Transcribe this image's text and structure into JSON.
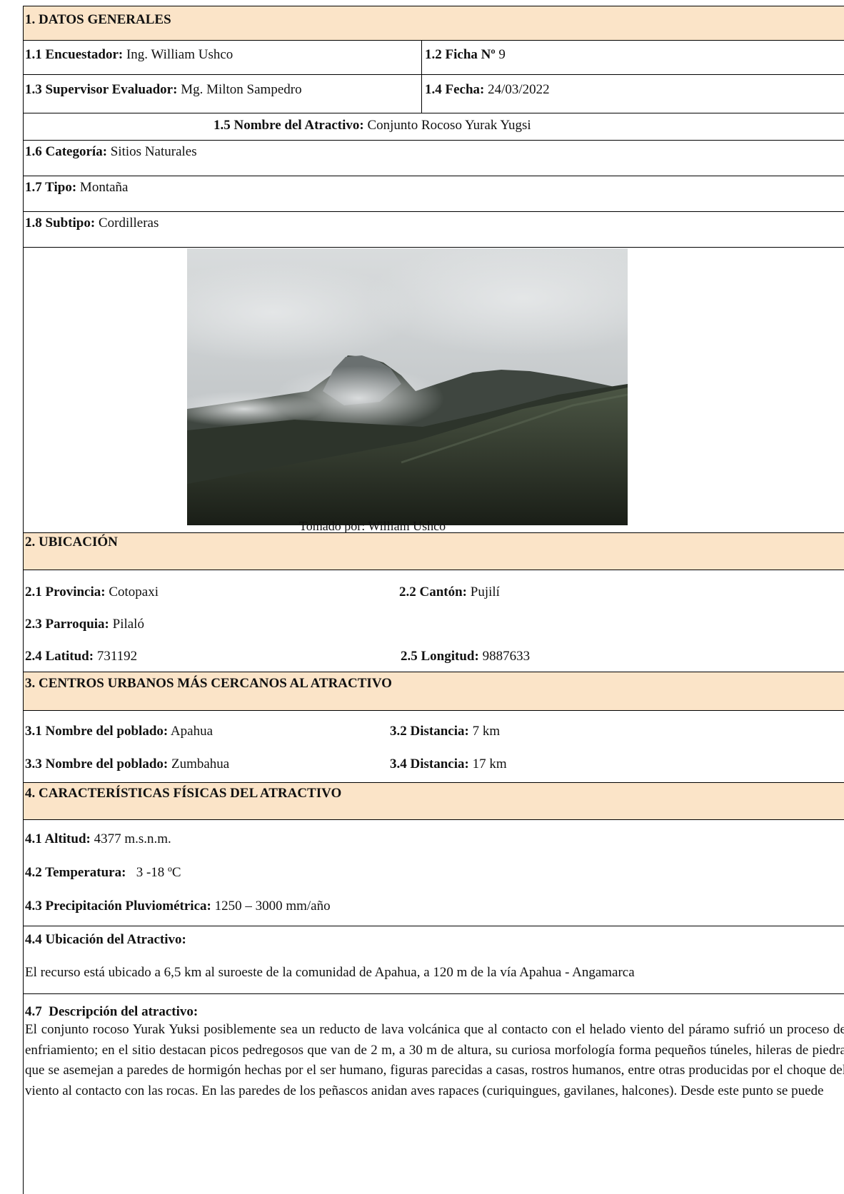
{
  "s1": {
    "title": "1. DATOS GENERALES",
    "f11_label": "1.1 Encuestador:",
    "f11_value": " Ing. William Ushco",
    "f12_label": "1.2 Ficha Nº",
    "f12_value": " 9",
    "f13_label": "1.3 Supervisor Evaluador:",
    "f13_value": " Mg. Milton Sampedro",
    "f14_label": "1.4 Fecha:",
    "f14_value": " 24/03/2022",
    "f15_label": "1.5 Nombre del Atractivo:",
    "f15_value": " Conjunto Rocoso Yurak Yugsi",
    "f16_label": "1.6 Categoría:",
    "f16_value": " Sitios Naturales",
    "f17_label": "1.7 Tipo:",
    "f17_value": " Montaña",
    "f18_label": "1.8 Subtipo:",
    "f18_value": " Cordilleras",
    "photo_caption": "Tomado por: William Ushco"
  },
  "s2": {
    "title": "2. UBICACIÓN",
    "f21_label": "2.1 Provincia:",
    "f21_value": " Cotopaxi",
    "f22_label": "2.2 Cantón:",
    "f22_value": " Pujilí",
    "f23_label": "2.3 Parroquia:",
    "f23_value": " Pilaló",
    "f24_label": "2.4 Latitud:",
    "f24_value": " 731192",
    "f25_label": "2.5 Longitud:",
    "f25_value": " 9887633"
  },
  "s3": {
    "title": "3. CENTROS URBANOS MÁS CERCANOS AL ATRACTIVO",
    "f31_label": "3.1 Nombre del poblado:",
    "f31_value": " Apahua",
    "f32_label": "3.2 Distancia:",
    "f32_value": " 7 km",
    "f33_label": "3.3 Nombre del poblado:",
    "f33_value": " Zumbahua",
    "f34_label": "3.4 Distancia:",
    "f34_value": " 17 km"
  },
  "s4": {
    "title": "4. CARACTERÍSTICAS FÍSICAS DEL ATRACTIVO",
    "f41_label": "4.1 Altitud:",
    "f41_value": " 4377 m.s.n.m.",
    "f42_label": "4.2 Temperatura:",
    "f42_value": "   3 -18 ºC",
    "f43_label": "4.3 Precipitación Pluviométrica:",
    "f43_value": " 1250 – 3000 mm/año",
    "f44_label": "4.4 Ubicación del Atractivo:",
    "f44_text": "El recurso está ubicado a 6,5 km al suroeste de la comunidad de Apahua, a 120 m de la vía Apahua - Angamarca",
    "f47_label": "4.7  Descripción del atractivo:",
    "f47_text": "El conjunto rocoso Yurak Yuksi posiblemente sea un reducto de lava volcánica que al contacto con el helado viento del páramo sufrió un proceso de enfriamiento; en el sitio destacan picos pedregosos que van de 2 m, a 30 m de altura, su curiosa morfología forma pequeños túneles, hileras de piedra que se asemejan a paredes de hormigón hechas por el ser humano, figuras parecidas a casas, rostros humanos, entre otras producidas por el choque del viento al contacto con las rocas. En las paredes de los peñascos anidan aves rapaces (curiquingues, gavilanes, halcones). Desde este punto se puede"
  }
}
